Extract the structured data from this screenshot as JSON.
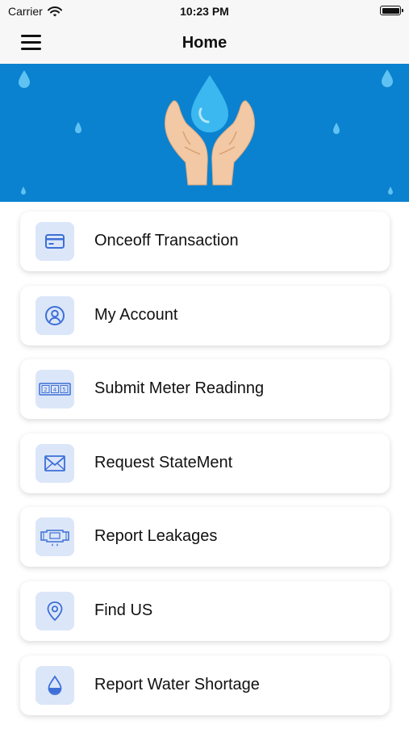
{
  "status_bar": {
    "carrier": "Carrier",
    "time": "10:23 PM"
  },
  "nav": {
    "title": "Home",
    "menu_icon": "hamburger-menu-icon"
  },
  "banner": {
    "background_color": "#0a82d0",
    "illustration": "hands-holding-water-drop"
  },
  "menu": {
    "accent_color": "#3d6fd6",
    "items": [
      {
        "label": "Onceoff Transaction",
        "icon": "credit-card-icon"
      },
      {
        "label": "My Account",
        "icon": "user-circle-icon"
      },
      {
        "label": "Submit Meter Readinng",
        "icon": "meter-reading-icon"
      },
      {
        "label": "Request StateMent",
        "icon": "envelope-icon"
      },
      {
        "label": "Report Leakages",
        "icon": "leaking-pipe-icon"
      },
      {
        "label": "Find US",
        "icon": "location-pin-icon"
      },
      {
        "label": "Report Water Shortage",
        "icon": "water-drop-icon"
      }
    ]
  }
}
